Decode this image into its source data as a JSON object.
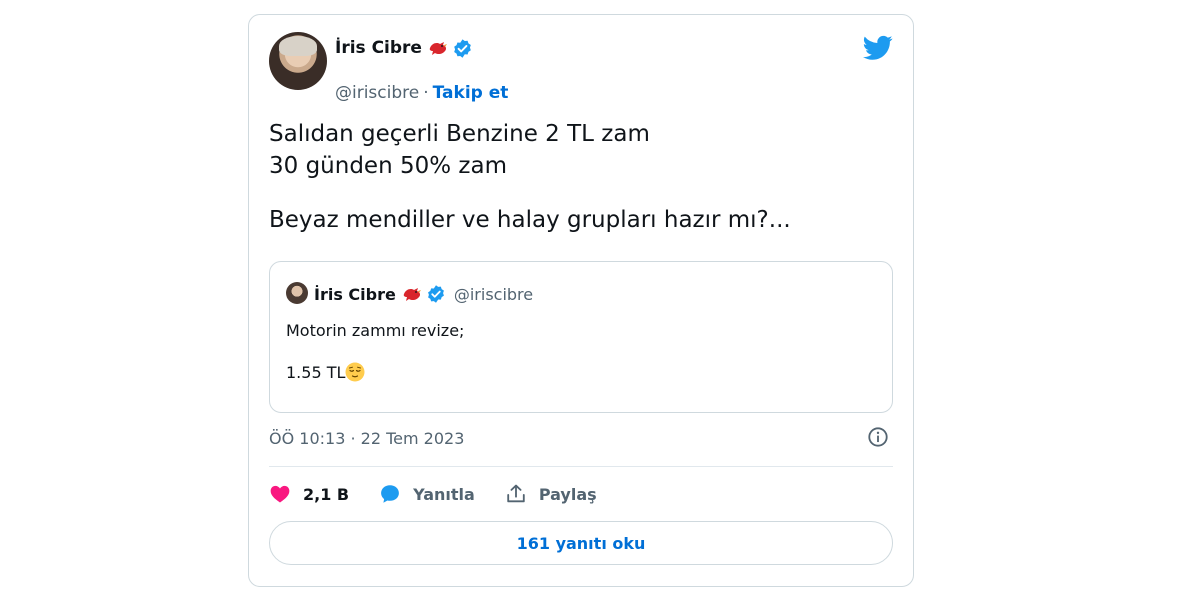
{
  "tweet": {
    "author_name": "İris Cibre",
    "author_handle": "@iriscibre",
    "separator": "·",
    "follow_label": "Takip et",
    "text_lines": [
      "Salıdan geçerli Benzine 2 TL zam",
      "30 günden 50% zam",
      "",
      "Beyaz mendiller ve halay grupları hazır mı?..."
    ],
    "timestamp": "ÖÖ 10:13 · 22 Tem 2023"
  },
  "quoted_tweet": {
    "author_name": "İris Cibre",
    "author_handle": "@iriscibre",
    "text_lines": [
      "Motorin zammı revize;",
      "",
      "1.55 TL"
    ]
  },
  "actions": {
    "like_count": "2,1 B",
    "reply_label": "Yanıtla",
    "share_label": "Paylaş"
  },
  "read_replies_label": "161 yanıtı oku",
  "icons": {
    "logo": "twitter-bird-icon",
    "verified": "verified-badge-icon",
    "bird_emoji": "red-bird-emoji",
    "face_emoji": "relieved-face-emoji",
    "info": "info-icon",
    "like": "heart-icon",
    "reply": "speech-bubble-icon",
    "share": "share-upload-icon"
  },
  "colors": {
    "accent_blue": "#1d9bf0",
    "link_blue": "#006fd6",
    "heart_pink": "#f91880",
    "secondary_text": "#536471",
    "border": "#cfd9de"
  }
}
